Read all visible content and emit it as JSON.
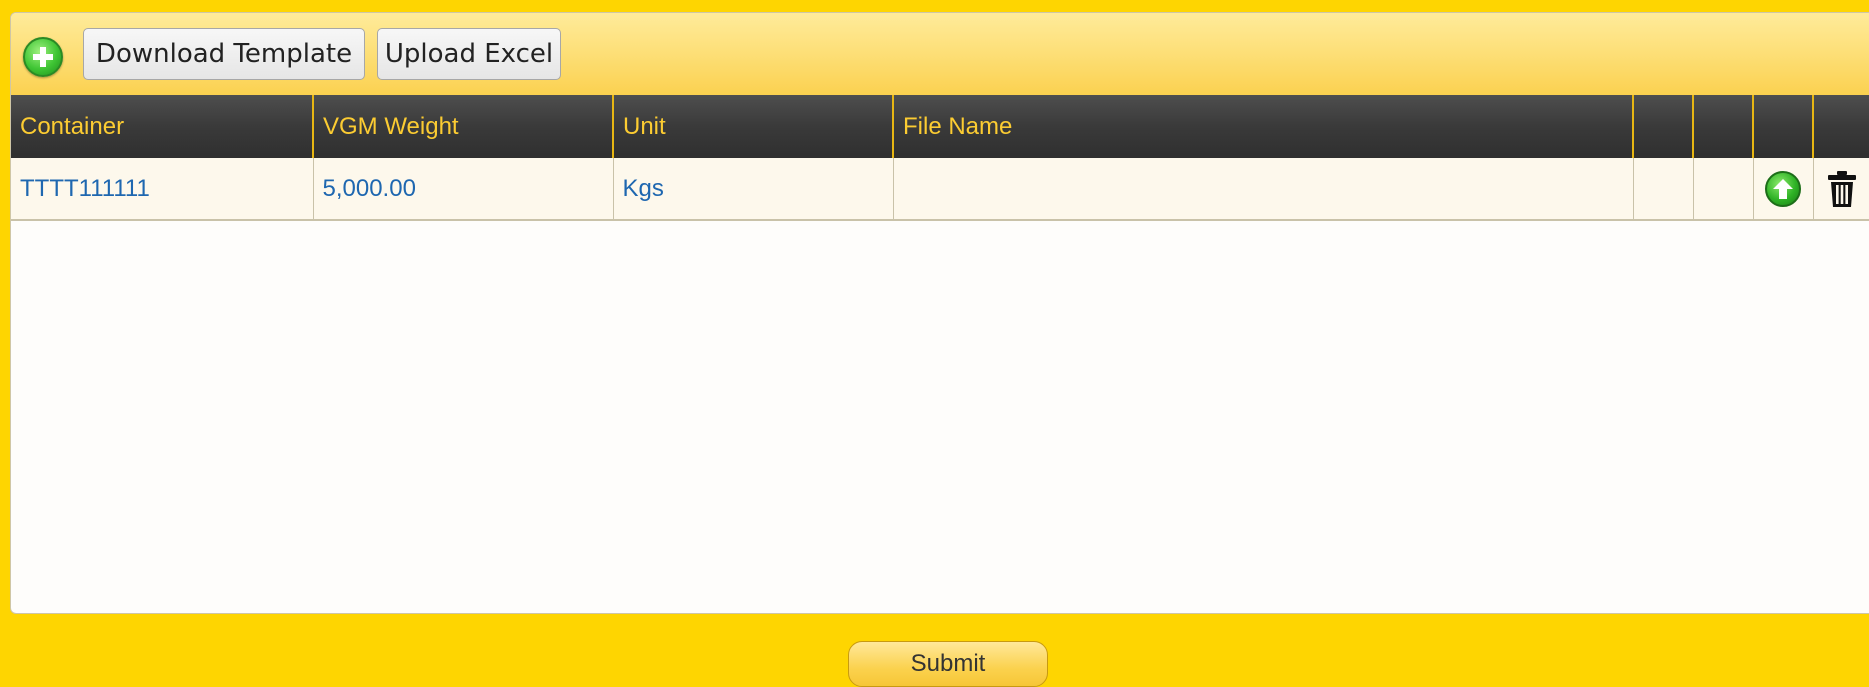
{
  "toolbar": {
    "add_icon": "plus-circle-icon",
    "download_label": "Download Template",
    "upload_label": "Upload Excel"
  },
  "grid": {
    "columns": [
      "Container",
      "VGM Weight",
      "Unit",
      "File Name",
      "",
      "",
      "",
      ""
    ],
    "rows": [
      {
        "container": "TTTT111111",
        "vgm_weight": "5,000.00",
        "unit": "Kgs",
        "file_name": "",
        "upload_icon": "upload-arrow-icon",
        "delete_icon": "trash-icon"
      }
    ]
  },
  "submit_label": "Submit",
  "colors": {
    "page_background": "#fed501",
    "header_background": "#3a3a3a",
    "header_text": "#fccc32",
    "cell_text": "#1e67b0"
  }
}
